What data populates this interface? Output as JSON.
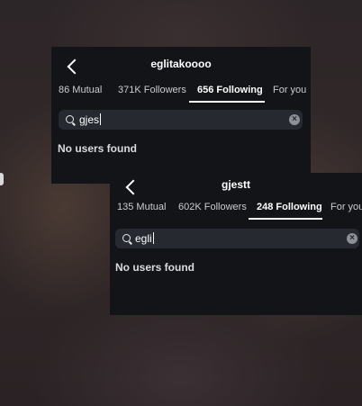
{
  "screens": [
    {
      "title": "eglitakoooo",
      "tabs": [
        {
          "label": "86 Mutual",
          "active": false
        },
        {
          "label": "371K Followers",
          "active": false
        },
        {
          "label": "656 Following",
          "active": true
        },
        {
          "label": "For you",
          "active": false
        }
      ],
      "search": {
        "query": "gjes"
      },
      "empty_message": "No users found"
    },
    {
      "title": "gjestt",
      "tabs": [
        {
          "label": "135 Mutual",
          "active": false
        },
        {
          "label": "602K Followers",
          "active": false
        },
        {
          "label": "248 Following",
          "active": true
        },
        {
          "label": "For you",
          "active": false
        }
      ],
      "search": {
        "query": "egli"
      },
      "empty_message": "No users found"
    }
  ],
  "icons": {
    "back": "chevron-left-icon",
    "search": "search-icon",
    "clear": "clear-icon"
  },
  "colors": {
    "panel_bg": "#121418",
    "search_bg": "#262a30",
    "active_underline": "#ffffff"
  }
}
